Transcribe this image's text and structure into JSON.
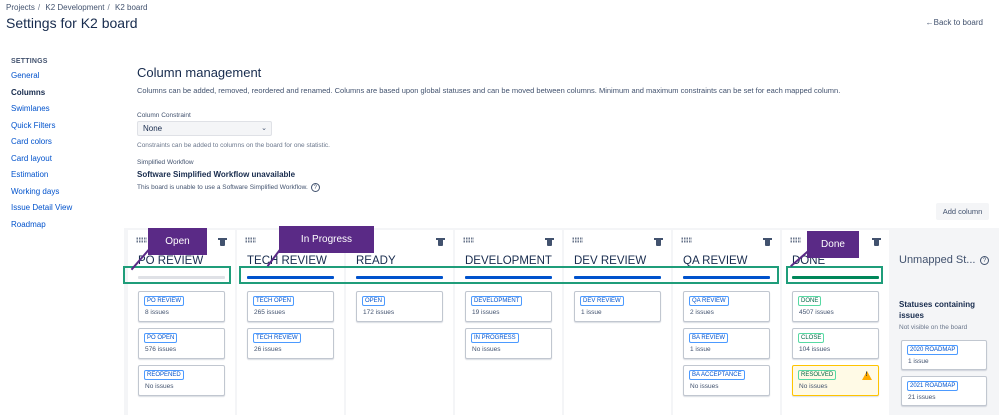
{
  "breadcrumb": [
    "Projects",
    "K2 Development",
    "K2 board"
  ],
  "page_title": "Settings for K2 board",
  "back_link": "Back to board",
  "sidebar": {
    "heading": "SETTINGS",
    "items": [
      {
        "label": "General",
        "active": false
      },
      {
        "label": "Columns",
        "active": true
      },
      {
        "label": "Swimlanes",
        "active": false
      },
      {
        "label": "Quick Filters",
        "active": false
      },
      {
        "label": "Card colors",
        "active": false
      },
      {
        "label": "Card layout",
        "active": false
      },
      {
        "label": "Estimation",
        "active": false
      },
      {
        "label": "Working days",
        "active": false
      },
      {
        "label": "Issue Detail View",
        "active": false
      },
      {
        "label": "Roadmap",
        "active": false
      }
    ]
  },
  "main": {
    "title": "Column management",
    "description": "Columns can be added, removed, reordered and renamed. Columns are based upon global statuses and can be moved between columns. Minimum and maximum constraints can be set for each mapped column.",
    "constraint_label": "Column Constraint",
    "constraint_value": "None",
    "constraint_help": "Constraints can be added to columns on the board for one statistic.",
    "simplified_label": "Simplified Workflow",
    "simplified_title": "Software Simplified Workflow unavailable",
    "simplified_note": "This board is unable to use a Software Simplified Workflow.",
    "add_column": "Add column"
  },
  "columns": [
    {
      "name": "PO REVIEW",
      "bar": "gray",
      "cards": [
        {
          "status": "PO REVIEW",
          "count": "8 issues"
        },
        {
          "status": "PO OPEN",
          "count": "576 issues"
        },
        {
          "status": "REOPENED",
          "count": "No issues"
        }
      ]
    },
    {
      "name": "TECH REVIEW",
      "bar": "blue",
      "cards": [
        {
          "status": "TECH OPEN",
          "count": "265 issues"
        },
        {
          "status": "TECH REVIEW",
          "count": "26 issues"
        }
      ]
    },
    {
      "name": "READY",
      "bar": "blue",
      "cards": [
        {
          "status": "OPEN",
          "count": "172 issues"
        }
      ]
    },
    {
      "name": "DEVELOPMENT",
      "bar": "blue",
      "cards": [
        {
          "status": "DEVELOPMENT",
          "count": "19 issues"
        },
        {
          "status": "IN PROGRESS",
          "count": "No issues"
        }
      ]
    },
    {
      "name": "DEV REVIEW",
      "bar": "blue",
      "cards": [
        {
          "status": "DEV REVIEW",
          "count": "1 issue"
        }
      ]
    },
    {
      "name": "QA REVIEW",
      "bar": "blue",
      "cards": [
        {
          "status": "QA REVIEW",
          "count": "2 issues"
        },
        {
          "status": "BA REVIEW",
          "count": "1 issue"
        },
        {
          "status": "BA ACCEPTANCE",
          "count": "No issues"
        }
      ]
    },
    {
      "name": "DONE",
      "bar": "green",
      "cards": [
        {
          "status": "DONE",
          "count": "4507 issues",
          "color": "green"
        },
        {
          "status": "CLOSE",
          "count": "104 issues",
          "color": "green"
        },
        {
          "status": "RESOLVED",
          "count": "No issues",
          "color": "green",
          "warning": true
        }
      ]
    }
  ],
  "unmapped": {
    "title": "Unmapped St...",
    "subtitle": "Statuses containing issues",
    "note": "Not visible on the board",
    "cards": [
      {
        "status": "2020 ROADMAP",
        "count": "1 issue"
      },
      {
        "status": "2021 ROADMAP",
        "count": "21 issues"
      }
    ]
  },
  "annotations": {
    "callouts": [
      "Open",
      "In Progress",
      "Done"
    ],
    "highlight_color": "#1f9d7a",
    "callout_color": "#5a2a86"
  },
  "colors": {
    "link": "#0052cc",
    "bar_blue": "#0052cc",
    "bar_green": "#00875a",
    "bar_gray": "#dfe1e6"
  }
}
